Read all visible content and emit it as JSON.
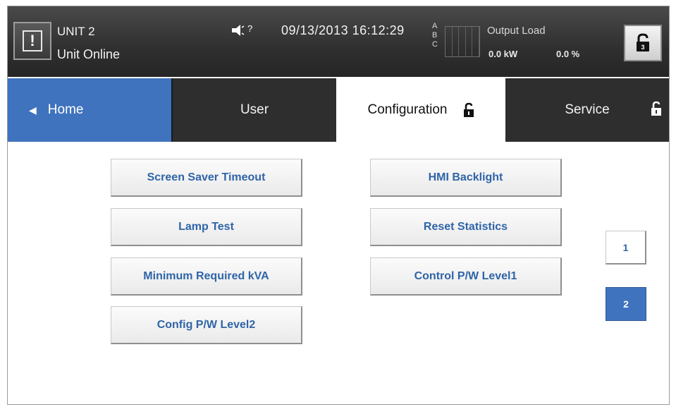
{
  "header": {
    "alarm_symbol": "!",
    "unit_name": "UNIT 2",
    "unit_status": "Unit Online",
    "help_glyph": "?",
    "datetime": "09/13/2013  16:12:29",
    "phases": [
      "A",
      "B",
      "C"
    ],
    "output_title": "Output Load",
    "output_kw": "0.0 kW",
    "output_pct": "0.0 %",
    "lock_level": "3"
  },
  "tabs": {
    "home": "Home",
    "user": "User",
    "configuration": "Configuration",
    "service": "Service"
  },
  "buttons": {
    "left": [
      "Screen Saver Timeout",
      "Lamp Test",
      "Minimum Required kVA",
      "Config P/W Level2"
    ],
    "right": [
      "HMI Backlight",
      "Reset Statistics",
      "Control P/W Level1"
    ]
  },
  "pages": [
    "1",
    "2"
  ],
  "pages_current": "2",
  "colors": {
    "accent_blue": "#3f73be",
    "button_text": "#2f64a8",
    "header_dark": "#2e2e2e"
  },
  "icons": {
    "alarm": "alarm-icon",
    "mute": "mute-speaker-icon",
    "lock": "padlock-icon",
    "home_arrow": "left-triangle-icon"
  }
}
